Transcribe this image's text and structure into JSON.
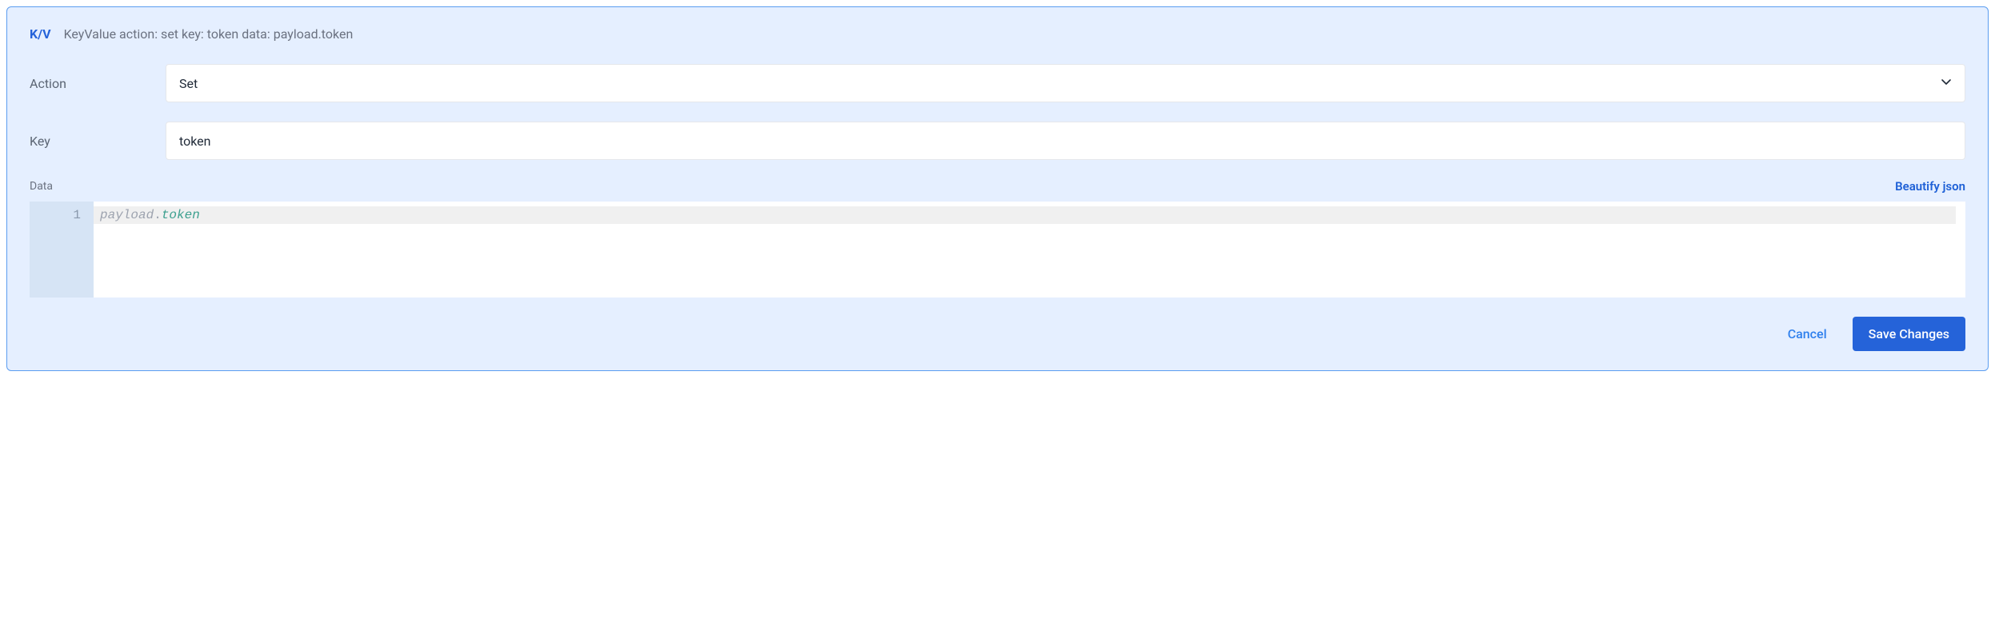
{
  "header": {
    "badge": "K/V",
    "title": "KeyValue action: set key: token data: payload.token"
  },
  "form": {
    "action": {
      "label": "Action",
      "value": "Set"
    },
    "key": {
      "label": "Key",
      "value": "token"
    },
    "data": {
      "label": "Data",
      "beautify": "Beautify json",
      "lineNumber": "1",
      "codeObj": "payload",
      "codeDot": ".",
      "codeProp": "token"
    }
  },
  "footer": {
    "cancel": "Cancel",
    "save": "Save Changes"
  }
}
